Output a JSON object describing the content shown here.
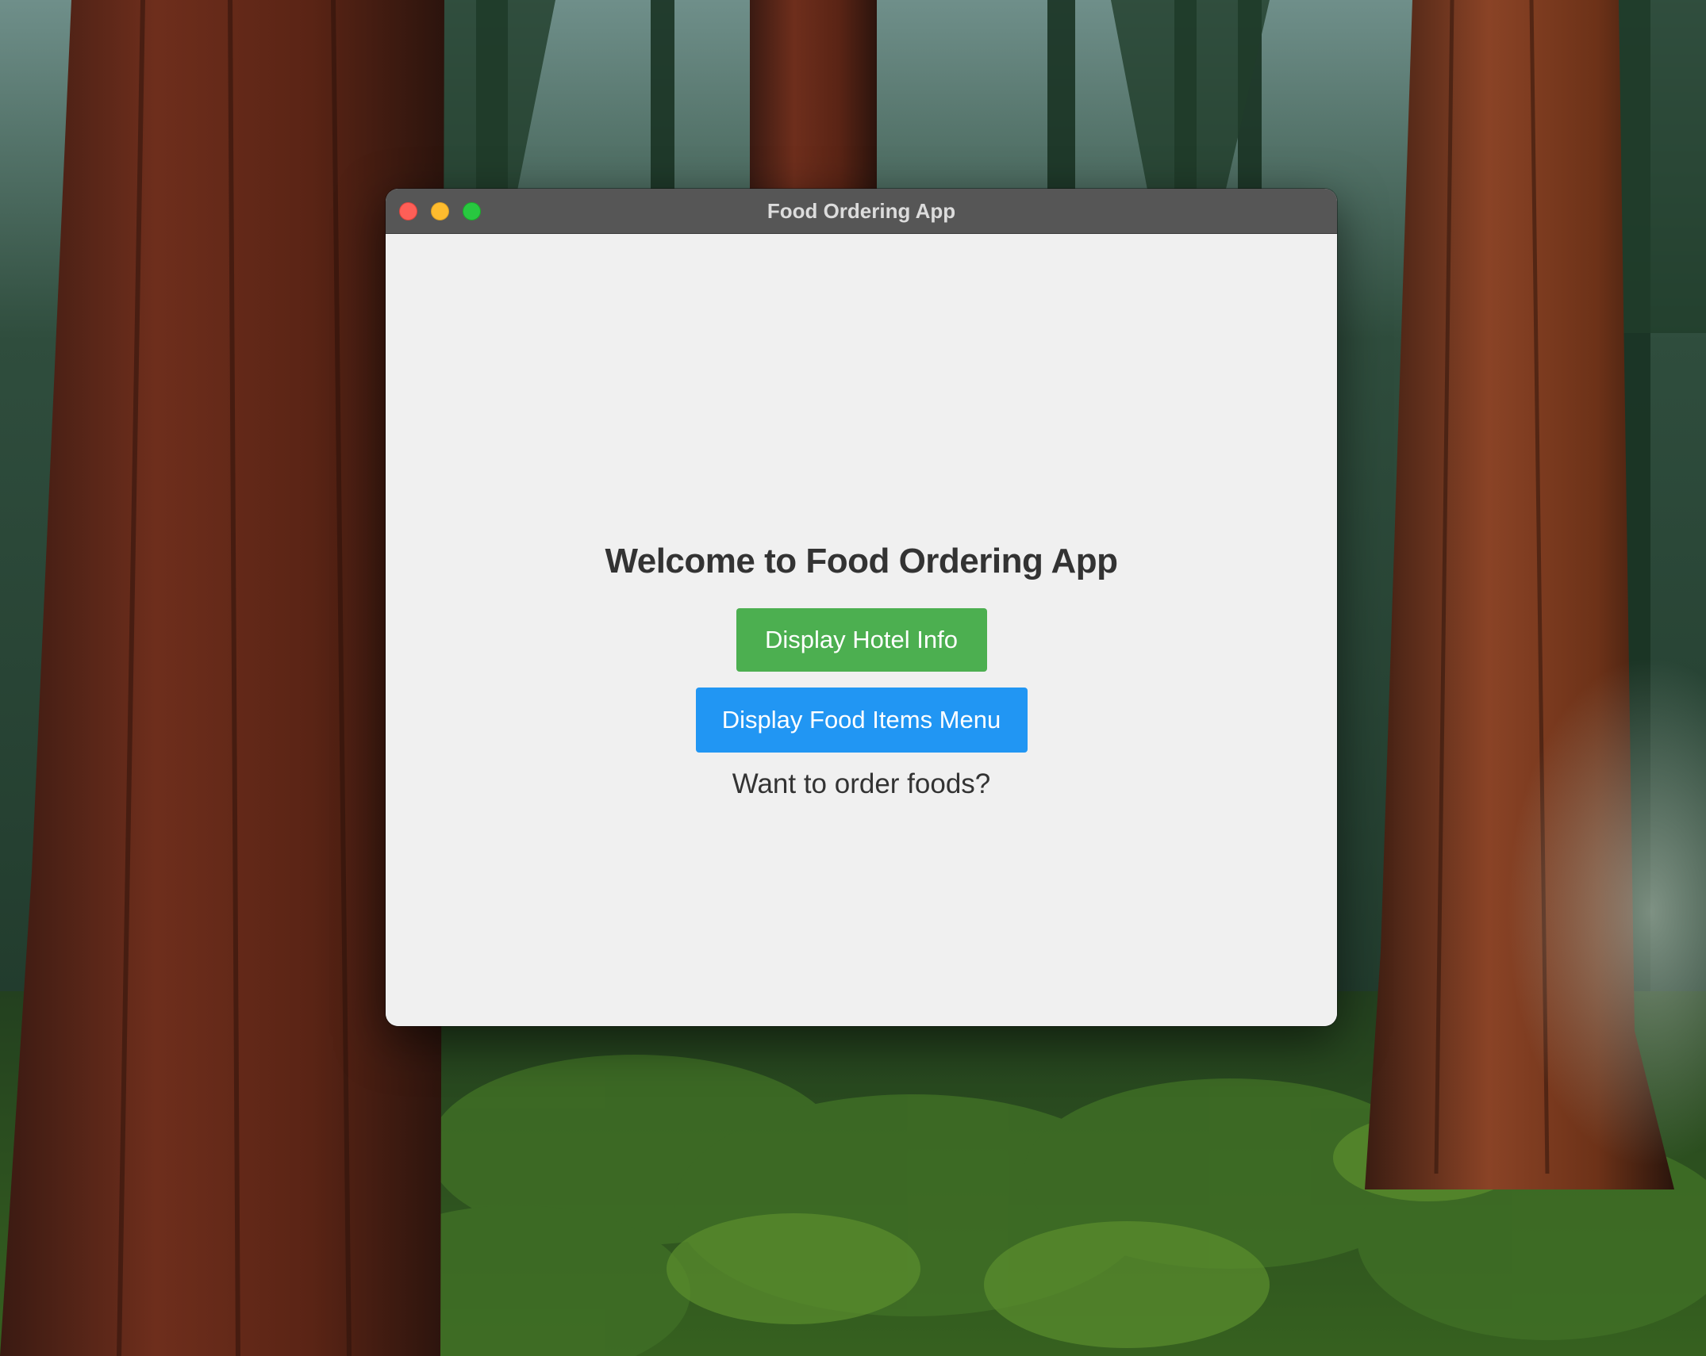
{
  "window": {
    "title": "Food Ordering App"
  },
  "main": {
    "heading": "Welcome to Food Ordering App",
    "hotel_button_label": "Display Hotel Info",
    "menu_button_label": "Display Food Items Menu",
    "prompt_text": "Want to order foods?"
  },
  "colors": {
    "titlebar": "#565656",
    "window_bg": "#f0f0f0",
    "hotel_button": "#4caf50",
    "menu_button": "#2196f3",
    "text": "#333333",
    "close": "#fe5f57",
    "minimize": "#febc2e",
    "maximize": "#28c840"
  },
  "icons": {
    "close": "close-icon",
    "minimize": "minimize-icon",
    "maximize": "maximize-icon"
  }
}
